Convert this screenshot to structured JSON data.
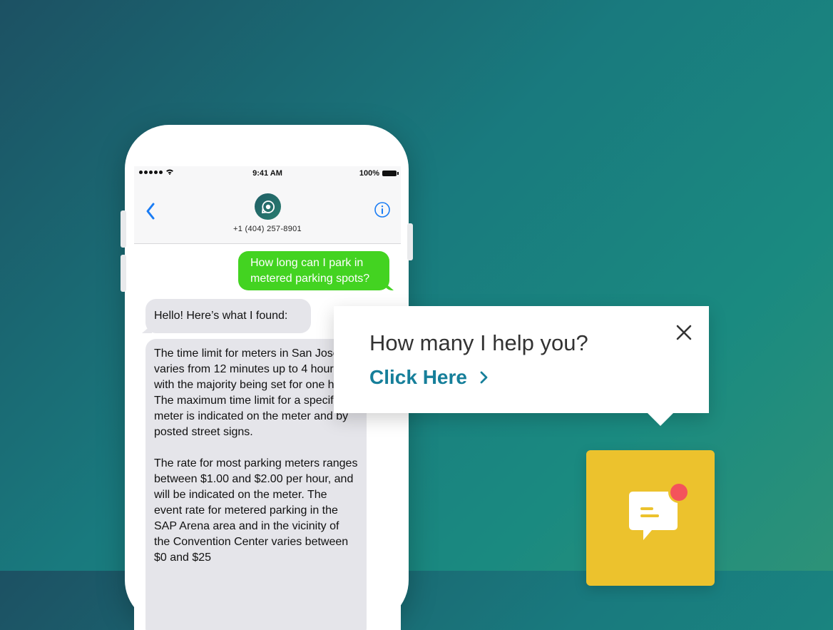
{
  "phone": {
    "status": {
      "time": "9:41 AM",
      "battery": "100%"
    },
    "contact": {
      "number": "+1 (404) 257-8901"
    },
    "messages": {
      "outgoing": "How long can I park in metered parking spots?",
      "incoming_1": "Hello! Here’s what I found:",
      "incoming_2": "The time limit for meters in San Jose varies from 12 minutes up to 4 hours with the majority being set for one hour. The maximum time limit for a specific meter is indicated on the meter and by posted street signs.\n\nThe rate for most parking meters ranges between $1.00 and $2.00 per hour, and will be indicated on the meter. The event rate for metered parking in the SAP Arena area and in the vicinity of the Convention Center varies between $0 and $25"
    }
  },
  "popup": {
    "title": "How many I help you?",
    "link": "Click Here"
  },
  "icons": {
    "back": "chevron-left-icon",
    "info": "info-icon",
    "close": "close-icon",
    "chat": "chat-bubble-icon",
    "notification": "notification-dot-icon"
  },
  "colors": {
    "sent_bubble": "#43d321",
    "received_bubble": "#e5e5ea",
    "link": "#167f9a",
    "ios_blue": "#1a7cf4",
    "widget": "#ecc22d",
    "notification": "#f4535b"
  }
}
